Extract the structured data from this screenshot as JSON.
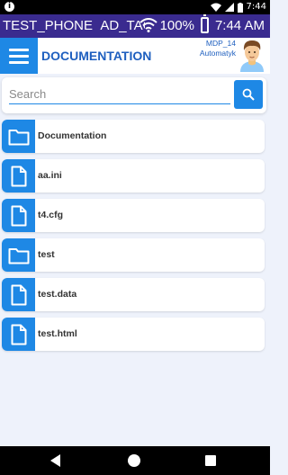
{
  "system_status": {
    "time": "7:44"
  },
  "app_status": {
    "device": "TEST_PHONE",
    "app_tag": "AD_TACT",
    "battery": "100%",
    "time": "7:44 AM"
  },
  "header": {
    "title": "DOCUMENTATION",
    "user_code": "MDP_14",
    "user_name": "Automatyk"
  },
  "search": {
    "placeholder": "Search"
  },
  "files": [
    {
      "name": "Documentation",
      "icon": "folder-icon"
    },
    {
      "name": "aa.ini",
      "icon": "file-icon"
    },
    {
      "name": "t4.cfg",
      "icon": "file-icon"
    },
    {
      "name": "test",
      "icon": "folder-icon"
    },
    {
      "name": "test.data",
      "icon": "file-icon"
    },
    {
      "name": "test.html",
      "icon": "file-icon"
    }
  ],
  "colors": {
    "accent": "#1e88e5",
    "title": "#1e5fbf",
    "strip": "#3a2b8f",
    "background": "#eef2fb"
  }
}
